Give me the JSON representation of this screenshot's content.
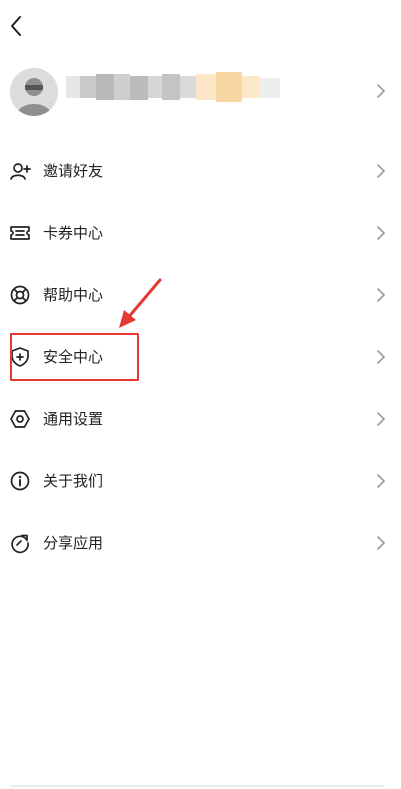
{
  "colors": {
    "accent": "#e53935",
    "text": "#222222",
    "chevron": "#9a9a9a"
  },
  "menu": [
    {
      "id": "invite",
      "label": "邀请好友",
      "icon": "user-plus-icon"
    },
    {
      "id": "coupons",
      "label": "卡券中心",
      "icon": "ticket-icon"
    },
    {
      "id": "help",
      "label": "帮助中心",
      "icon": "lifebuoy-icon"
    },
    {
      "id": "security",
      "label": "安全中心",
      "icon": "shield-icon"
    },
    {
      "id": "settings",
      "label": "通用设置",
      "icon": "hexagon-gear-icon"
    },
    {
      "id": "about",
      "label": "关于我们",
      "icon": "info-icon"
    },
    {
      "id": "share",
      "label": "分享应用",
      "icon": "share-refresh-icon"
    }
  ]
}
